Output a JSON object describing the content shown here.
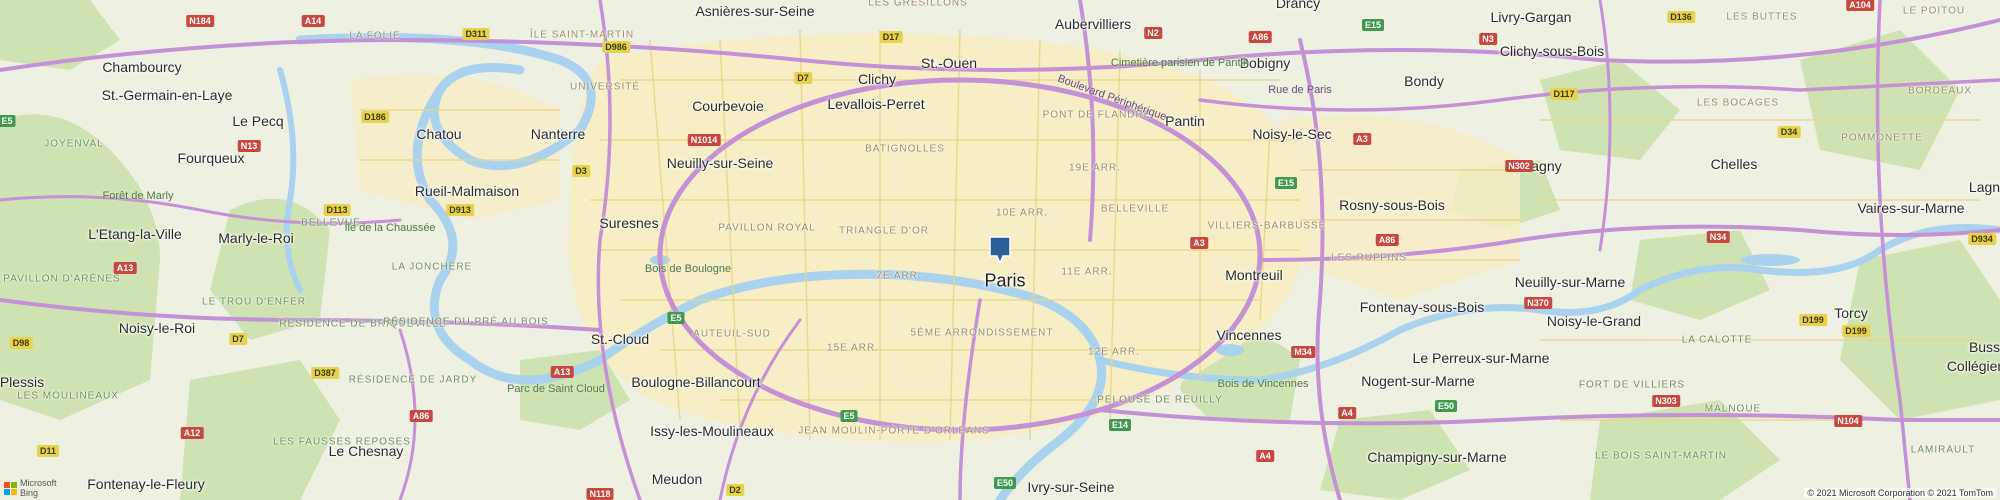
{
  "map": {
    "marker_label": "Paris",
    "attribution": "© 2021 Microsoft Corporation © 2021 TomTom",
    "logo": {
      "line1": "Microsoft",
      "line2": "Bing"
    },
    "icons": {
      "marker": "map-pin-icon",
      "logo": "microsoft-logo-icon"
    },
    "colors": {
      "land": "#f1efe6",
      "urban": "#f7eec6",
      "park": "#cfe3b2",
      "water": "#a9d2ef",
      "highway": "#c490d6",
      "road": "#e9d58a",
      "pin": "#2c5f95"
    }
  },
  "places": [
    {
      "name": "Asnières-sur-Seine"
    },
    {
      "name": "Aubervilliers"
    },
    {
      "name": "Drancy"
    },
    {
      "name": "Livry-Gargan"
    },
    {
      "name": "Clichy-sous-Bois"
    },
    {
      "name": "Chambourcy"
    },
    {
      "name": "St.-Germain-en-Laye"
    },
    {
      "name": "Courbevoie"
    },
    {
      "name": "Clichy"
    },
    {
      "name": "St.-Ouen"
    },
    {
      "name": "Levallois-Perret"
    },
    {
      "name": "Bobigny"
    },
    {
      "name": "Bondy"
    },
    {
      "name": "Le Pecq"
    },
    {
      "name": "Chatou"
    },
    {
      "name": "Nanterre"
    },
    {
      "name": "Pantin"
    },
    {
      "name": "Noisy-le-Sec"
    },
    {
      "name": "Fourqueux"
    },
    {
      "name": "Neuilly-sur-Seine"
    },
    {
      "name": "Gagny"
    },
    {
      "name": "Chelles"
    },
    {
      "name": "Rueil-Malmaison"
    },
    {
      "name": "Rosny-sous-Bois"
    },
    {
      "name": "Vaires-sur-Marne"
    },
    {
      "name": "Suresnes"
    },
    {
      "name": "L'Etang-la-Ville"
    },
    {
      "name": "Marly-le-Roi"
    },
    {
      "name": "Montreuil"
    },
    {
      "name": "Neuilly-sur-Marne"
    },
    {
      "name": "Fontenay-sous-Bois"
    },
    {
      "name": "Torcy"
    },
    {
      "name": "Noisy-le-Roi"
    },
    {
      "name": "St.-Cloud"
    },
    {
      "name": "Vincennes"
    },
    {
      "name": "Noisy-le-Grand"
    },
    {
      "name": "Le Perreux-sur-Marne"
    },
    {
      "name": "Boulogne-Billancourt"
    },
    {
      "name": "Nogent-sur-Marne"
    },
    {
      "name": "Issy-les-Moulineaux"
    },
    {
      "name": "Le Chesnay"
    },
    {
      "name": "Champigny-sur-Marne"
    },
    {
      "name": "Fontenay-le-Fleury"
    },
    {
      "name": "Meudon"
    },
    {
      "name": "Ivry-sur-Seine"
    },
    {
      "name": "Lagny"
    },
    {
      "name": "Bussy"
    },
    {
      "name": "Collégien"
    },
    {
      "name": "Plessis"
    }
  ],
  "districts": [
    {
      "name": "LES GRESILLONS"
    },
    {
      "name": "ÎLE SAINT-MARTIN"
    },
    {
      "name": "LA FOLIE"
    },
    {
      "name": "UNIVERSITÉ"
    },
    {
      "name": "LES BUTTES"
    },
    {
      "name": "LE POITOU"
    },
    {
      "name": "BORDEAUX"
    },
    {
      "name": "BATIGNOLLES"
    },
    {
      "name": "PONT DE FLANDRE"
    },
    {
      "name": "LES BOCAGES"
    },
    {
      "name": "POMMONETTE"
    },
    {
      "name": "JOYENVAL"
    },
    {
      "name": "19E ARR."
    },
    {
      "name": "10E ARR."
    },
    {
      "name": "BELLEVILLE"
    },
    {
      "name": "BELLEVUE"
    },
    {
      "name": "PAVILLON ROYAL"
    },
    {
      "name": "TRIANGLE D'OR"
    },
    {
      "name": "VILLIERS-BARBUSSE"
    },
    {
      "name": "LES RUFFINS"
    },
    {
      "name": "LA JONCHÈRE"
    },
    {
      "name": "PAVILLON D'ARÉNES"
    },
    {
      "name": "7E ARR."
    },
    {
      "name": "11E ARR."
    },
    {
      "name": "LE TROU D'ENFER"
    },
    {
      "name": "RÉSIDENCE DE BRIQUEVILLE"
    },
    {
      "name": "RÉSIDENCE DU PRÉ AU BOIS"
    },
    {
      "name": "AUTEUIL-SUD"
    },
    {
      "name": "5ÈME ARRONDISSEMENT"
    },
    {
      "name": "15E ARR."
    },
    {
      "name": "12E ARR."
    },
    {
      "name": "LA CALOTTE"
    },
    {
      "name": "RÉSIDENCE DE JARDY"
    },
    {
      "name": "LES MOULINEAUX"
    },
    {
      "name": "PELOUSE DE REUILLY"
    },
    {
      "name": "FORT DE VILLIERS"
    },
    {
      "name": "MALNOUE"
    },
    {
      "name": "LES FAUSSES REPOSES"
    },
    {
      "name": "JEAN MOULIN-PORTE D'ORLEANS"
    },
    {
      "name": "LE BOIS SAINT-MARTIN"
    },
    {
      "name": "LAMIRAULT"
    }
  ],
  "parks": [
    {
      "name": "Forêt de Marly"
    },
    {
      "name": "Bois de Boulogne"
    },
    {
      "name": "Parc de Saint Cloud"
    },
    {
      "name": "Bois de Vincennes"
    },
    {
      "name": "Île de la Chaussée"
    },
    {
      "name": "Cimetière parisien de Pantin"
    }
  ],
  "roads": [
    {
      "name": "Boulevard Périphérique"
    },
    {
      "name": "Rue de Paris"
    }
  ],
  "shields": [
    {
      "label": "N184",
      "type": "n"
    },
    {
      "label": "A14",
      "type": "a"
    },
    {
      "label": "D311",
      "type": "d"
    },
    {
      "label": "D986",
      "type": "d"
    },
    {
      "label": "D17",
      "type": "d"
    },
    {
      "label": "N2",
      "type": "n"
    },
    {
      "label": "A86",
      "type": "a"
    },
    {
      "label": "E15",
      "type": "e"
    },
    {
      "label": "N3",
      "type": "n"
    },
    {
      "label": "D136",
      "type": "d"
    },
    {
      "label": "A104",
      "type": "a"
    },
    {
      "label": "D7",
      "type": "d"
    },
    {
      "label": "N1014",
      "type": "n"
    },
    {
      "label": "E5",
      "type": "e"
    },
    {
      "label": "D186",
      "type": "d"
    },
    {
      "label": "N13",
      "type": "n"
    },
    {
      "label": "D3",
      "type": "d"
    },
    {
      "label": "A3",
      "type": "a"
    },
    {
      "label": "N302",
      "type": "n"
    },
    {
      "label": "D34",
      "type": "d"
    },
    {
      "label": "D117",
      "type": "d"
    },
    {
      "label": "E15",
      "type": "e"
    },
    {
      "label": "D113",
      "type": "d"
    },
    {
      "label": "D913",
      "type": "d"
    },
    {
      "label": "A3",
      "type": "a"
    },
    {
      "label": "A86",
      "type": "a"
    },
    {
      "label": "N34",
      "type": "n"
    },
    {
      "label": "D934",
      "type": "d"
    },
    {
      "label": "A13",
      "type": "a"
    },
    {
      "label": "N370",
      "type": "n"
    },
    {
      "label": "E5",
      "type": "e"
    },
    {
      "label": "D199",
      "type": "d"
    },
    {
      "label": "D98",
      "type": "d"
    },
    {
      "label": "D7",
      "type": "d"
    },
    {
      "label": "D199",
      "type": "d"
    },
    {
      "label": "D387",
      "type": "d"
    },
    {
      "label": "A13",
      "type": "a"
    },
    {
      "label": "M34",
      "type": "n"
    },
    {
      "label": "A86",
      "type": "a"
    },
    {
      "label": "E5",
      "type": "e"
    },
    {
      "label": "N303",
      "type": "n"
    },
    {
      "label": "A12",
      "type": "a"
    },
    {
      "label": "E14",
      "type": "e"
    },
    {
      "label": "A4",
      "type": "a"
    },
    {
      "label": "E50",
      "type": "e"
    },
    {
      "label": "N104",
      "type": "n"
    },
    {
      "label": "D11",
      "type": "d"
    },
    {
      "label": "A4",
      "type": "a"
    },
    {
      "label": "D2",
      "type": "d"
    },
    {
      "label": "E50",
      "type": "e"
    },
    {
      "label": "N118",
      "type": "n"
    }
  ]
}
